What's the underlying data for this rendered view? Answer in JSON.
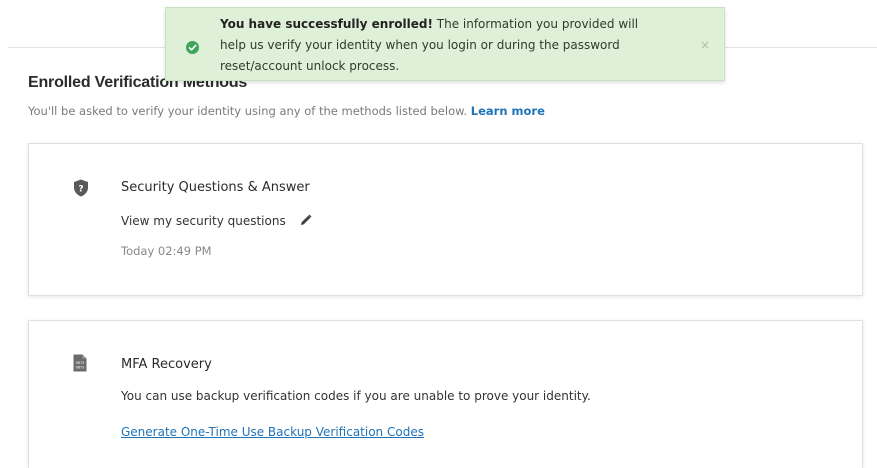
{
  "toast": {
    "bold": "You have successfully enrolled!",
    "line1_rest": " The information you provided will",
    "line2": "help us verify your identity when you login or during the password",
    "line3": "reset/account unlock process.",
    "close": "×"
  },
  "section": {
    "title": "Enrolled Verification Methods",
    "subtitle": "You'll be asked to verify your identity using any of the methods listed below.",
    "learn_more": "Learn more"
  },
  "security_card": {
    "title": "Security Questions & Answer",
    "view_link": "View my security questions",
    "timestamp": "Today 02:49 PM"
  },
  "mfa_card": {
    "title": "MFA Recovery",
    "description": "You can use backup verification codes if you are unable to prove your identity.",
    "generate_link": "Generate One-Time Use Backup Verification Codes",
    "icon_text_1": "9873",
    "icon_text_2": "9873"
  },
  "colors": {
    "toast_bg": "#dff0d8",
    "success_green": "#3ea55b",
    "link_blue": "#1f73b7"
  }
}
